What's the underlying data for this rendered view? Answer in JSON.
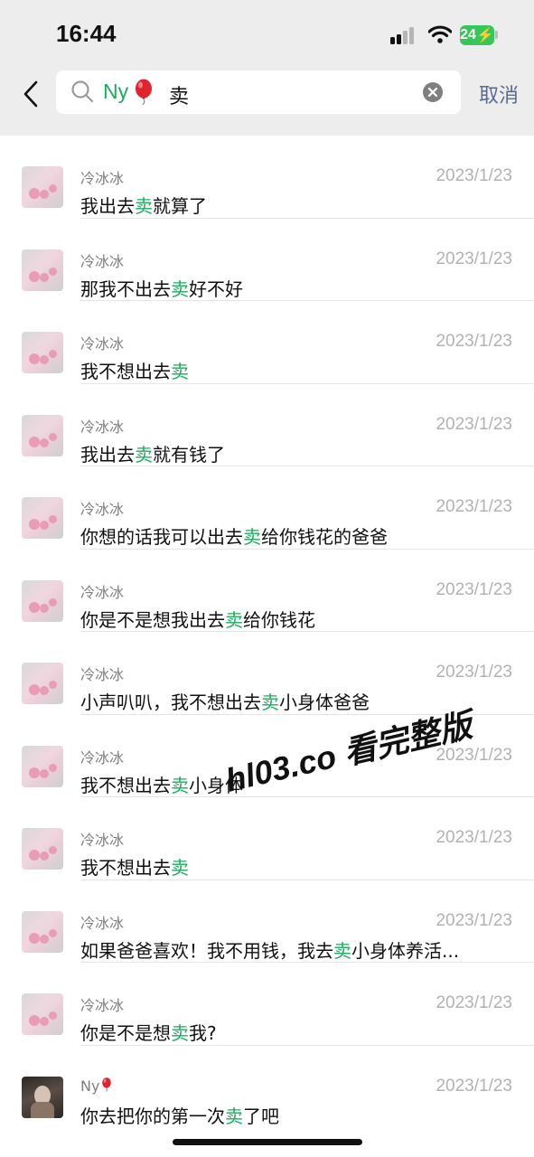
{
  "status_bar": {
    "time": "16:44",
    "battery": "24"
  },
  "search": {
    "tag": "Ny",
    "tag_emoji": "balloon",
    "query": "卖",
    "cancel_label": "取消"
  },
  "results": [
    {
      "name": "冷冰冰",
      "date": "2023/1/23",
      "before": "我出去",
      "hit": "卖",
      "after": "就算了"
    },
    {
      "name": "冷冰冰",
      "date": "2023/1/23",
      "before": "那我不出去",
      "hit": "卖",
      "after": "好不好"
    },
    {
      "name": "冷冰冰",
      "date": "2023/1/23",
      "before": "我不想出去",
      "hit": "卖",
      "after": ""
    },
    {
      "name": "冷冰冰",
      "date": "2023/1/23",
      "before": "我出去",
      "hit": "卖",
      "after": "就有钱了"
    },
    {
      "name": "冷冰冰",
      "date": "2023/1/23",
      "before": "你想的话我可以出去",
      "hit": "卖",
      "after": "给你钱花的爸爸"
    },
    {
      "name": "冷冰冰",
      "date": "2023/1/23",
      "before": "你是不是想我出去",
      "hit": "卖",
      "after": "给你钱花"
    },
    {
      "name": "冷冰冰",
      "date": "2023/1/23",
      "before": "小声叭叭，我不想出去",
      "hit": "卖",
      "after": "小身体爸爸"
    },
    {
      "name": "冷冰冰",
      "date": "2023/1/23",
      "before": "我不想出去",
      "hit": "卖",
      "after": "小身体"
    },
    {
      "name": "冷冰冰",
      "date": "2023/1/23",
      "before": "我不想出去",
      "hit": "卖",
      "after": ""
    },
    {
      "name": "冷冰冰",
      "date": "2023/1/23",
      "before": "如果爸爸喜欢！我不用钱，我去",
      "hit": "卖",
      "after": "小身体养活..."
    },
    {
      "name": "冷冰冰",
      "date": "2023/1/23",
      "before": "你是不是想",
      "hit": "卖",
      "after": "我?"
    },
    {
      "name": "Ny",
      "name_emoji": "balloon",
      "date": "2023/1/23",
      "before": "你去把你的第一次",
      "hit": "卖",
      "after": "了吧"
    }
  ],
  "watermark": "hl03.co 看完整版",
  "colors": {
    "highlight": "#1aad5b",
    "cancel": "#576b95",
    "header_bg": "#ededed"
  }
}
